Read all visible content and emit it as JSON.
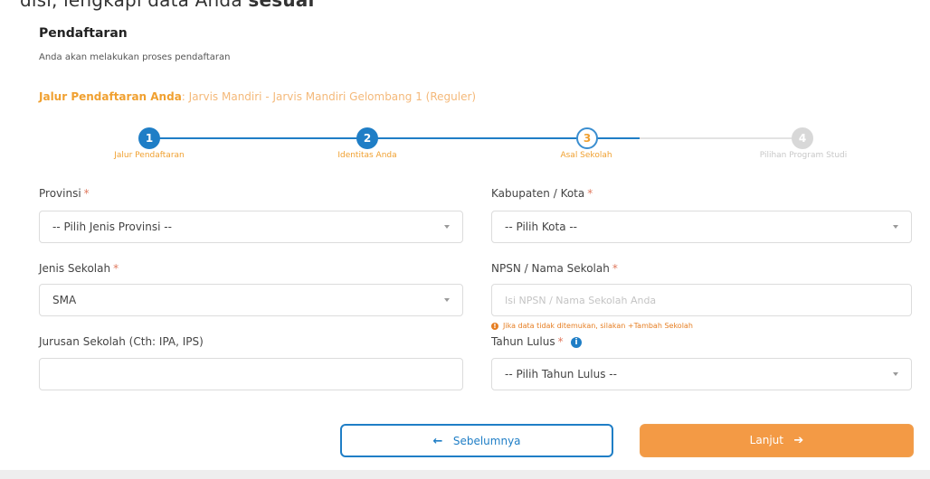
{
  "top_strip": {
    "text": "disi, lengkapi data Anda",
    "bold": "sesuai"
  },
  "header": {
    "title": "Pendaftaran",
    "subtitle": "Anda akan melakukan proses pendaftaran"
  },
  "jalur": {
    "label": "Jalur Pendaftaran Anda",
    "value": ": Jarvis Mandiri - Jarvis Mandiri Gelombang 1 (Reguler)"
  },
  "steps": [
    {
      "number": "1",
      "label": "Jalur Pendaftaran",
      "state": "done"
    },
    {
      "number": "2",
      "label": "Identitas Anda",
      "state": "done"
    },
    {
      "number": "3",
      "label": "Asal Sekolah",
      "state": "current"
    },
    {
      "number": "4",
      "label": "Pilihan Program Studi",
      "state": "todo"
    }
  ],
  "form": {
    "provinsi": {
      "label": "Provinsi",
      "required": "*",
      "value": "-- Pilih Jenis Provinsi --"
    },
    "kota": {
      "label": "Kabupaten / Kota",
      "required": "*",
      "value": "-- Pilih Kota --"
    },
    "jenis_sekolah": {
      "label": "Jenis Sekolah",
      "required": "*",
      "value": "SMA"
    },
    "npsn": {
      "label": "NPSN / Nama Sekolah",
      "required": "*",
      "placeholder": "Isi NPSN / Nama Sekolah Anda",
      "value": ""
    },
    "hint": {
      "icon": "!",
      "text": "Jika data tidak ditemukan, silakan +Tambah Sekolah"
    },
    "jurusan": {
      "label": "Jurusan Sekolah (Cth: IPA, IPS)",
      "value": ""
    },
    "tahun_lulus": {
      "label": "Tahun Lulus",
      "required": "*",
      "info_icon": "i",
      "value": "-- Pilih Tahun Lulus --"
    }
  },
  "buttons": {
    "prev": {
      "label": "Sebelumnya",
      "icon": "←"
    },
    "next": {
      "label": "Lanjut",
      "icon": "➔"
    }
  },
  "colors": {
    "primary_blue": "#1f7ec6",
    "accent_orange": "#f39a45",
    "step_inactive": "#d8d8d8"
  }
}
